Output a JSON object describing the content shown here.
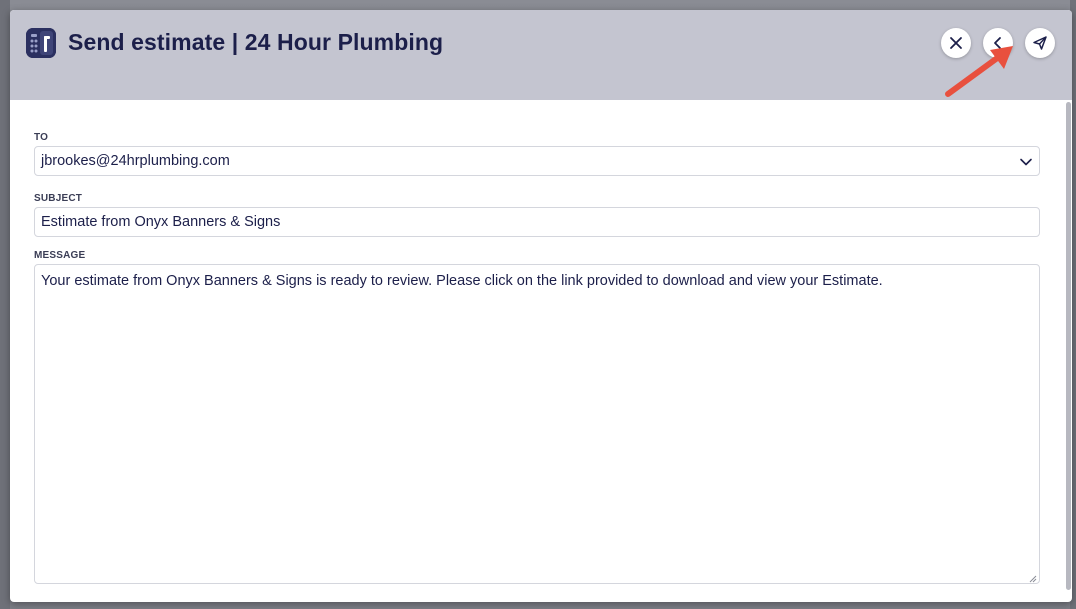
{
  "modal": {
    "title": "Send estimate | 24 Hour Plumbing",
    "logo_icon": "estimate-calculator-icon",
    "buttons": {
      "close_icon": "close-icon",
      "back_icon": "chevron-left-icon",
      "send_icon": "paper-plane-icon"
    }
  },
  "form": {
    "to": {
      "label": "TO",
      "value": "jbrookes@24hrplumbing.com",
      "dropdown_icon": "chevron-down-icon"
    },
    "subject": {
      "label": "SUBJECT",
      "value": "Estimate from Onyx Banners & Signs"
    },
    "message": {
      "label": "MESSAGE",
      "value": "Your estimate from Onyx Banners & Signs is ready to review. Please click on the link provided to download and view your Estimate."
    }
  },
  "colors": {
    "header_bg": "#c4c5d0",
    "title_text": "#1c1f4a",
    "annotation_arrow": "#e8503e",
    "overlay_bg": "#7d7f88"
  }
}
